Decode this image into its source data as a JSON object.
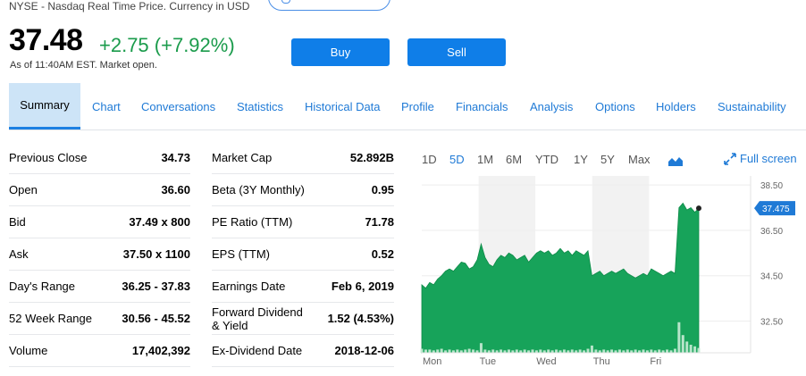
{
  "quote": {
    "market_note": "NYSE - Nasdaq Real Time Price. Currency in USD",
    "price": "37.48",
    "change": "+2.75 (+7.92%)",
    "as_of": "As of 11:40AM EST. Market open.",
    "change_color": "#1a9b4b"
  },
  "actions": {
    "buy": "Buy",
    "sell": "Sell",
    "accent": "#0f7ee8"
  },
  "tabs": [
    "Summary",
    "Chart",
    "Conversations",
    "Statistics",
    "Historical Data",
    "Profile",
    "Financials",
    "Analysis",
    "Options",
    "Holders",
    "Sustainability"
  ],
  "stats_left": [
    {
      "label": "Previous Close",
      "value": "34.73"
    },
    {
      "label": "Open",
      "value": "36.60"
    },
    {
      "label": "Bid",
      "value": "37.49 x 800"
    },
    {
      "label": "Ask",
      "value": "37.50 x 1100"
    },
    {
      "label": "Day's Range",
      "value": "36.25 - 37.83"
    },
    {
      "label": "52 Week Range",
      "value": "30.56 - 45.52"
    },
    {
      "label": "Volume",
      "value": "17,402,392"
    }
  ],
  "stats_right": [
    {
      "label": "Market Cap",
      "value": "52.892B"
    },
    {
      "label": "Beta (3Y Monthly)",
      "value": "0.95"
    },
    {
      "label": "PE Ratio (TTM)",
      "value": "71.78"
    },
    {
      "label": "EPS (TTM)",
      "value": "0.52"
    },
    {
      "label": "Earnings Date",
      "value": "Feb 6, 2019"
    },
    {
      "label": "Forward Dividend & Yield",
      "value": "1.52 (4.53%)"
    },
    {
      "label": "Ex-Dividend Date",
      "value": "2018-12-06"
    }
  ],
  "chart_controls": {
    "ranges": [
      "1D",
      "5D",
      "1M",
      "6M",
      "YTD",
      "1Y",
      "5Y",
      "Max"
    ],
    "active_range": "5D",
    "full_screen": "Full screen",
    "icons": [
      "mountain-chart-icon",
      "expand-arrows-icon"
    ]
  },
  "chart_data": {
    "type": "area",
    "x_ticks": [
      "Mon",
      "Tue",
      "Wed",
      "Thu",
      "Fri"
    ],
    "y_ticks": [
      "38.50",
      "36.50",
      "34.50",
      "32.50"
    ],
    "ylim": [
      31.1,
      38.9
    ],
    "current_label": "37.475",
    "fill_color": "#17a35a",
    "series": [
      {
        "values": [
          34.1,
          33.95,
          34.2,
          34.1,
          34.35,
          34.5,
          34.7,
          34.8,
          34.7,
          34.9,
          35.1,
          35.05,
          34.8,
          34.9,
          35.2,
          35.9,
          35.3,
          35.0,
          34.9,
          35.2,
          35.4,
          35.3,
          35.5,
          35.4,
          35.2,
          35.3,
          35.4,
          35.1,
          35.3,
          35.5,
          35.6,
          35.5,
          35.6,
          35.4,
          35.5,
          35.7,
          35.5,
          35.6,
          35.4,
          35.6,
          35.5,
          35.4,
          35.6,
          34.5,
          34.6,
          34.7,
          34.5,
          34.6,
          34.7,
          34.6,
          34.7,
          34.8,
          34.6,
          34.5,
          34.4,
          34.5,
          34.6,
          34.5,
          34.8,
          34.7,
          34.6,
          34.5,
          34.6,
          34.7,
          34.6,
          37.5,
          37.7,
          37.4,
          37.5,
          37.3,
          37.475
        ]
      }
    ],
    "volume": [
      5,
      4,
      4,
      3,
      4,
      5,
      3,
      4,
      3,
      4,
      3,
      4,
      5,
      4,
      3,
      12,
      4,
      3,
      4,
      3,
      4,
      3,
      4,
      3,
      4,
      3,
      4,
      3,
      4,
      3,
      4,
      3,
      4,
      3,
      4,
      3,
      4,
      3,
      4,
      3,
      4,
      3,
      5,
      9,
      4,
      3,
      4,
      3,
      4,
      3,
      4,
      3,
      4,
      3,
      4,
      3,
      4,
      3,
      4,
      3,
      4,
      3,
      4,
      3,
      5,
      38,
      22,
      14,
      10,
      8,
      6
    ]
  }
}
